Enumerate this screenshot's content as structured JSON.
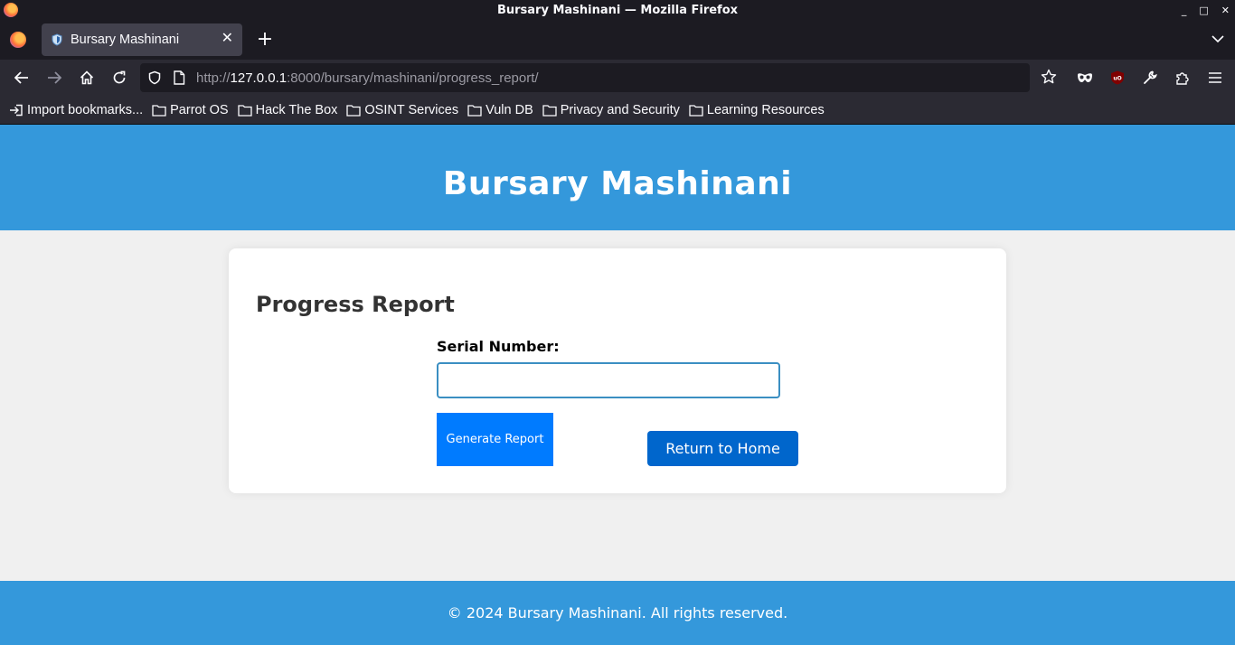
{
  "window": {
    "title": "Bursary Mashinani — Mozilla Firefox",
    "controls": [
      "_",
      "□",
      "✕"
    ]
  },
  "tabs": [
    {
      "label": "Bursary Mashinani",
      "close": "✕"
    }
  ],
  "new_tab_label": "+",
  "url": {
    "scheme": "http://",
    "host": "127.0.0.1",
    "rest": ":8000/bursary/mashinani/progress_report/"
  },
  "bookmarks": [
    {
      "label": "Import bookmarks...",
      "icon": "import-icon"
    },
    {
      "label": "Parrot OS",
      "icon": "folder-icon"
    },
    {
      "label": "Hack The Box",
      "icon": "folder-icon"
    },
    {
      "label": "OSINT Services",
      "icon": "folder-icon"
    },
    {
      "label": "Vuln DB",
      "icon": "folder-icon"
    },
    {
      "label": "Privacy and Security",
      "icon": "folder-icon"
    },
    {
      "label": "Learning Resources",
      "icon": "folder-icon"
    }
  ],
  "page": {
    "header_title": "Bursary Mashinani",
    "section_title": "Progress Report",
    "serial_label": "Serial Number:",
    "serial_value": "",
    "generate_label": "Generate Report",
    "home_label": "Return to Home",
    "footer": "© 2024 Bursary Mashinani. All rights reserved."
  },
  "colors": {
    "brand": "#3498db",
    "primary_button": "#007bff",
    "home_button": "#0066cc",
    "chrome_dark": "#1c1b22",
    "chrome_toolbar": "#2b2a33"
  }
}
